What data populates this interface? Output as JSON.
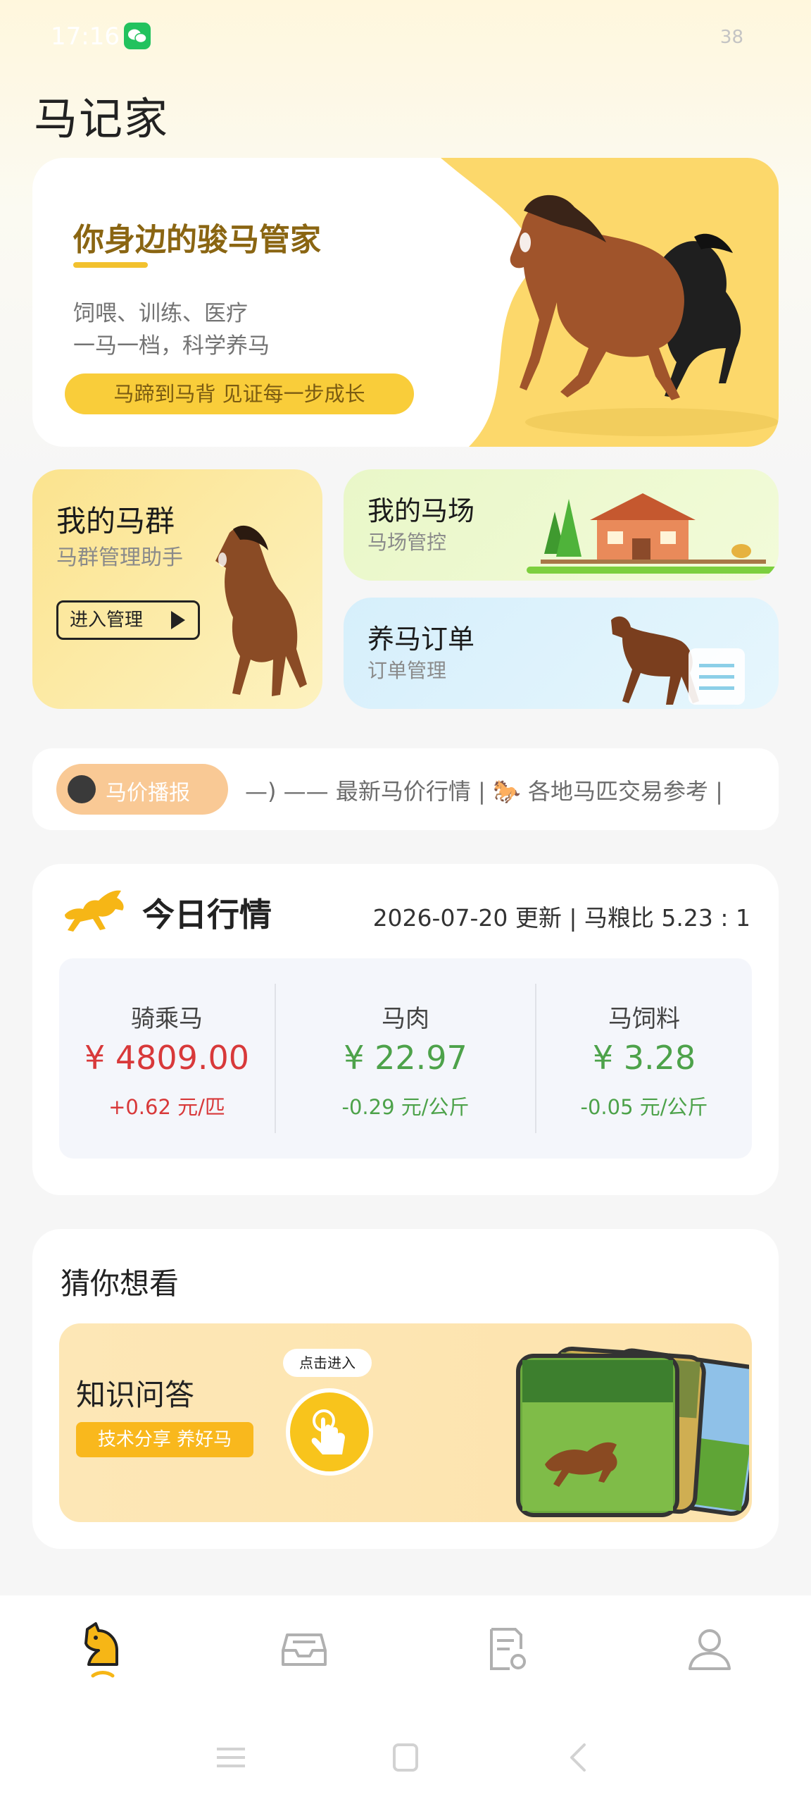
{
  "status_bar": {
    "time": "17:16",
    "battery": "38"
  },
  "app": {
    "title": "马记家"
  },
  "hero": {
    "title": "你身边的骏马管家",
    "desc_line1": "饲喂、训练、医疗",
    "desc_line2": "一马一档，科学养马",
    "badge": "马蹄到马背  见证每一步成长"
  },
  "cards": {
    "group": {
      "title": "我的马群",
      "subtitle": "马群管理助手",
      "button": "进入管理"
    },
    "farm": {
      "title": "我的马场",
      "subtitle": "马场管控"
    },
    "order": {
      "title": "养马订单",
      "subtitle": "订单管理"
    }
  },
  "ticker": {
    "badge": "马价播报",
    "text": "—) —— 最新马价行情 | 🐎 各地马匹交易参考 |"
  },
  "market": {
    "title": "今日行情",
    "date_info": "2026-07-20 更新  |  马粮比 5.23 : 1",
    "items": [
      {
        "name": "骑乘马",
        "price": "¥ 4809.00",
        "change": "+0.62 元/匹",
        "trend": "up"
      },
      {
        "name": "马肉",
        "price": "¥ 22.97",
        "change": "-0.29 元/公斤",
        "trend": "down"
      },
      {
        "name": "马饲料",
        "price": "¥ 3.28",
        "change": "-0.05 元/公斤",
        "trend": "down"
      }
    ],
    "colors": {
      "up": "#d8393a",
      "down": "#4da24a"
    }
  },
  "guess": {
    "title": "猜你想看",
    "card_title": "知识问答",
    "card_tag": "技术分享 养好马",
    "enter_label": "点击进入"
  },
  "nav": {
    "items": [
      {
        "icon": "horse-head-icon",
        "active": true
      },
      {
        "icon": "inbox-icon",
        "active": false
      },
      {
        "icon": "document-settings-icon",
        "active": false
      },
      {
        "icon": "profile-icon",
        "active": false
      }
    ]
  },
  "system_nav": {
    "icons": [
      "menu-icon",
      "home-icon",
      "back-icon"
    ]
  }
}
